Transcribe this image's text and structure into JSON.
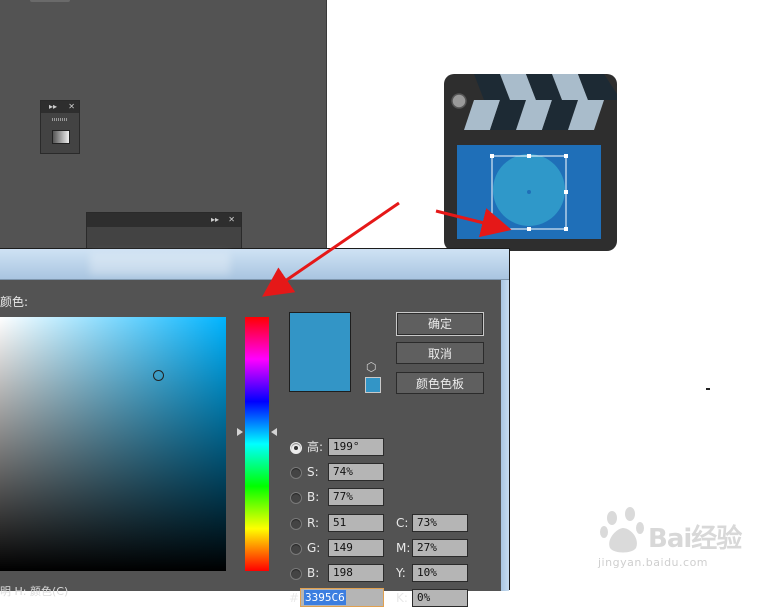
{
  "dialog": {
    "color_label": "颜色:",
    "ok_button": "确定",
    "cancel_button": "取消",
    "color_library_button": "颜色色板",
    "current_color": "#3395C6",
    "picker_field_hue_color": "#00b4ff",
    "hsb": [
      {
        "label": "高:",
        "value": "199°",
        "selected": true
      },
      {
        "label": "S:",
        "value": "74%",
        "selected": false
      },
      {
        "label": "B:",
        "value": "77%",
        "selected": false
      }
    ],
    "rgb": [
      {
        "label": "R:",
        "value": "51"
      },
      {
        "label": "G:",
        "value": "149"
      },
      {
        "label": "B:",
        "value": "198"
      }
    ],
    "cmyk": [
      {
        "label": "C:",
        "value": "73%"
      },
      {
        "label": "M:",
        "value": "27%"
      },
      {
        "label": "Y:",
        "value": "10%"
      },
      {
        "label": "K:",
        "value": "0%"
      }
    ],
    "hex_label": "#",
    "hex_value": "3395C6",
    "bottom_text": "明 H: 颜色(C)"
  },
  "artwork": {
    "board_color": "#2e2e2e",
    "screen_color": "#1f6fb8",
    "circle_color": "#2f98c9",
    "stripe_light": "#a9bccb",
    "stripe_dark": "#1d2a34"
  },
  "watermark": {
    "text": "Bai经验",
    "subtext": "jingyan.baidu.com"
  }
}
